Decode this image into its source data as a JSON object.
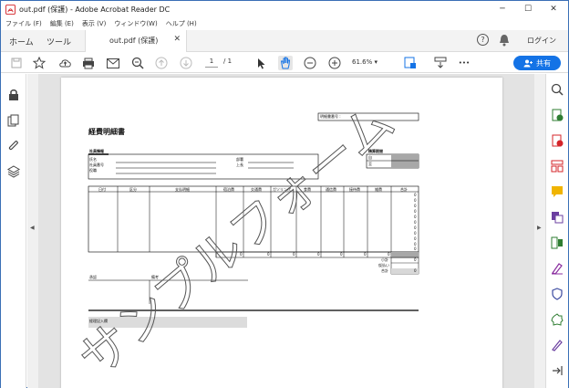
{
  "window": {
    "title": "out.pdf (保護) - Adobe Acrobat Reader DC",
    "minimize": "─",
    "maximize": "☐",
    "close": "✕"
  },
  "menu": [
    "ファイル (F)",
    "編集 (E)",
    "表示 (V)",
    "ウィンドウ(W)",
    "ヘルプ (H)"
  ],
  "tabs": {
    "home": "ホーム",
    "tools": "ツール",
    "document": "out.pdf (保護)",
    "help": "?",
    "login": "ログイン"
  },
  "toolbar": {
    "page_current": "1",
    "page_total": "/ 1",
    "zoom": "61.6%",
    "share": "共有",
    "more": "•••"
  },
  "colors": {
    "accent": "#1473e6",
    "window_border": "#3b6fb6",
    "form_shade": "#a8a8a8"
  },
  "form": {
    "title": "経費明細書",
    "doc_number_label": "明細書番号 :",
    "applicant_header": "社員情報",
    "name_label": "氏名",
    "employee_no_label": "社員番号",
    "position_label": "役職",
    "department_label": "部署",
    "manager_label": "上長",
    "period_header": "精算期間",
    "from_label": "自",
    "to_label": "至",
    "columns": [
      "日付",
      "区分",
      "支払明細",
      "宿泊費",
      "交通費",
      "ガソリン代",
      "食費",
      "通信費",
      "接待費",
      "雑費",
      "合計"
    ],
    "row_total_values": [
      "0",
      "0",
      "0",
      "0",
      "0",
      "0",
      "0",
      "0",
      "0",
      "0",
      "0"
    ],
    "column_totals": [
      "0",
      "0",
      "0",
      "0",
      "0",
      "0",
      "0"
    ],
    "subtotal_label": "小計",
    "advance_label": "仮払い",
    "total_label": "合計",
    "subtotal_value": "0",
    "total_value": "0",
    "approval_label": "承認",
    "remarks_label": "備考",
    "accounting_label": "経理記入欄"
  },
  "watermark": "サンプルフォーム"
}
